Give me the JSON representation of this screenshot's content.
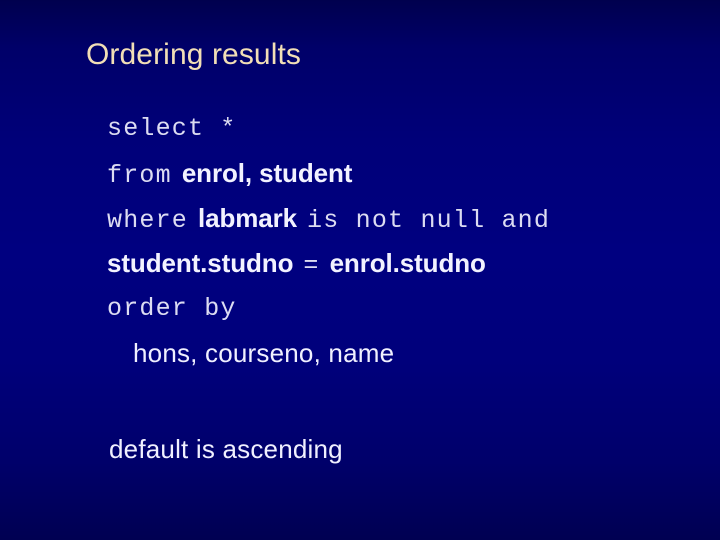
{
  "slide": {
    "title": "Ordering results",
    "background_color_top": "#00004e",
    "background_color_mid": "#000080",
    "background_color_bottom": "#000052",
    "title_color": "#f2dfb6",
    "keyword_color": "#dcdcf2",
    "identifier_color": "#f2f2ff"
  },
  "query": {
    "line1": {
      "keyword": "select",
      "operand": "*"
    },
    "line2": {
      "keyword": "from",
      "identifiers": "enrol, student"
    },
    "line3": {
      "keyword": "where",
      "identifier": "labmark",
      "keyword_tail": "is not null and"
    },
    "line4": {
      "left": "student.studno",
      "operator": "=",
      "right": "enrol.studno"
    },
    "line5": {
      "keyword": "order by"
    },
    "line6": {
      "columns": "hons,  courseno,  name"
    }
  },
  "footnote": {
    "text": "default is ascending"
  }
}
